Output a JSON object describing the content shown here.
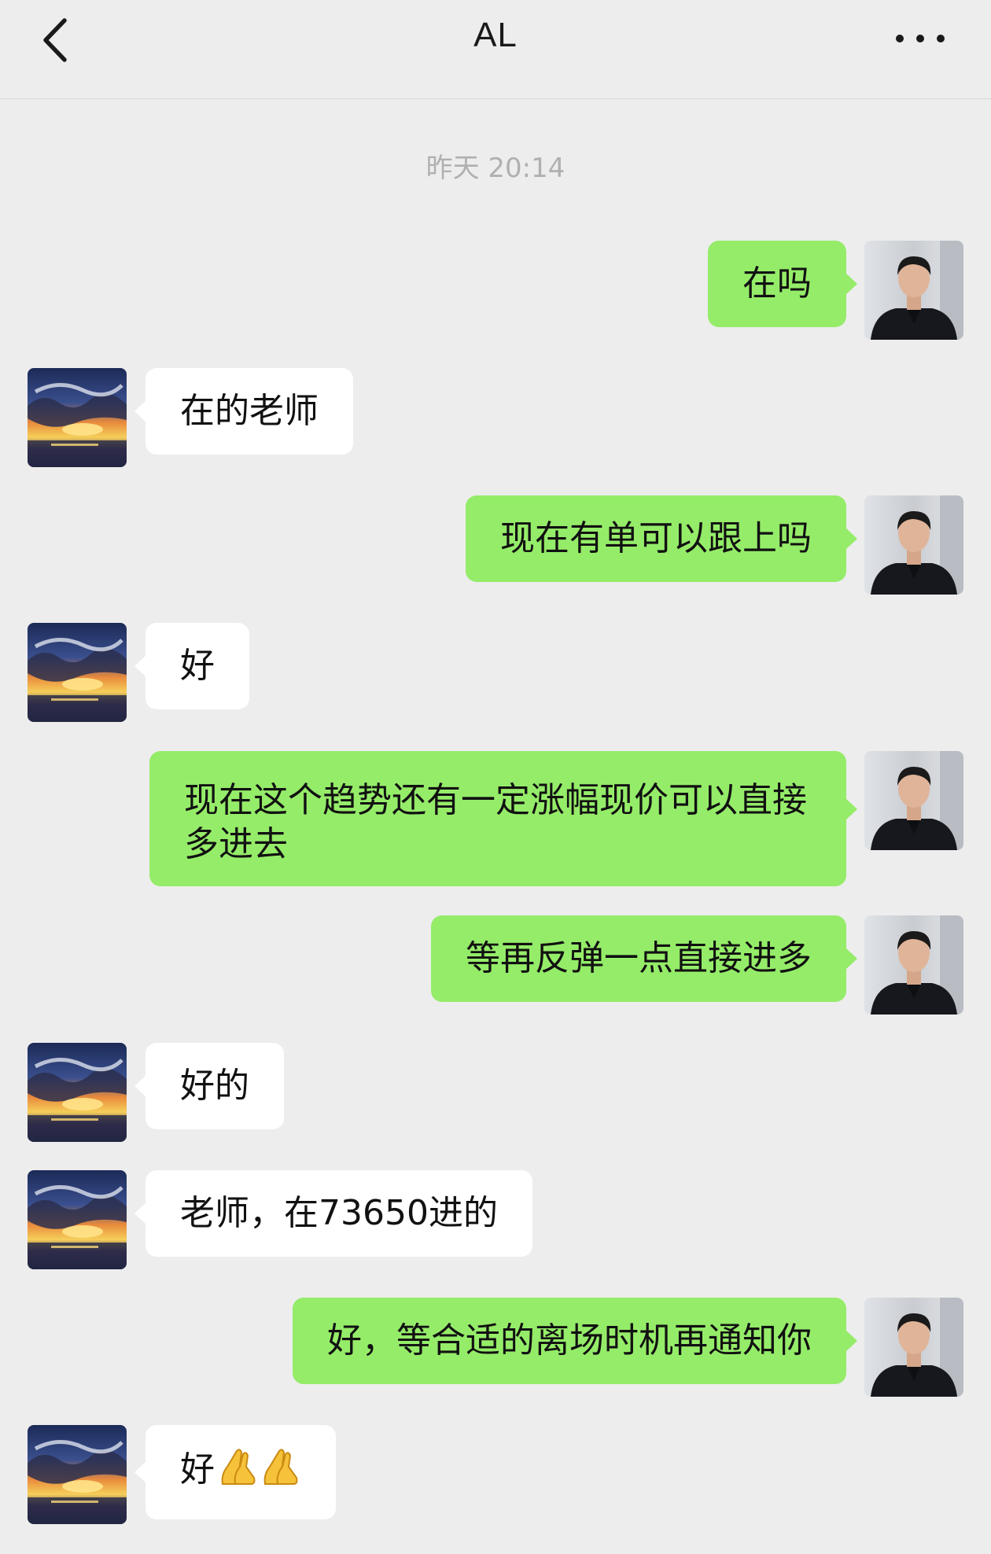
{
  "header": {
    "title": "AL",
    "back_icon": "chevron-left-icon",
    "more_icon": "more-dots-icon"
  },
  "timestamp": "昨天 20:14",
  "messages": [
    {
      "sender": "me",
      "text": "在吗"
    },
    {
      "sender": "other",
      "text": "在的老师"
    },
    {
      "sender": "me",
      "text": "现在有单可以跟上吗"
    },
    {
      "sender": "other",
      "text": "好"
    },
    {
      "sender": "me",
      "text": "现在这个趋势还有一定涨幅现价可以直接多进去"
    },
    {
      "sender": "me",
      "text": "等再反弹一点直接进多"
    },
    {
      "sender": "other",
      "text": "好的"
    },
    {
      "sender": "other",
      "text": "老师，在73650进的"
    },
    {
      "sender": "me",
      "text": "好，等合适的离场时机再通知你"
    },
    {
      "sender": "other",
      "text": "好",
      "emoji": "folded-hands-icon"
    }
  ],
  "colors": {
    "background": "#ededed",
    "my_bubble": "#95ec69",
    "other_bubble": "#ffffff",
    "timestamp": "#b0b0b0"
  }
}
